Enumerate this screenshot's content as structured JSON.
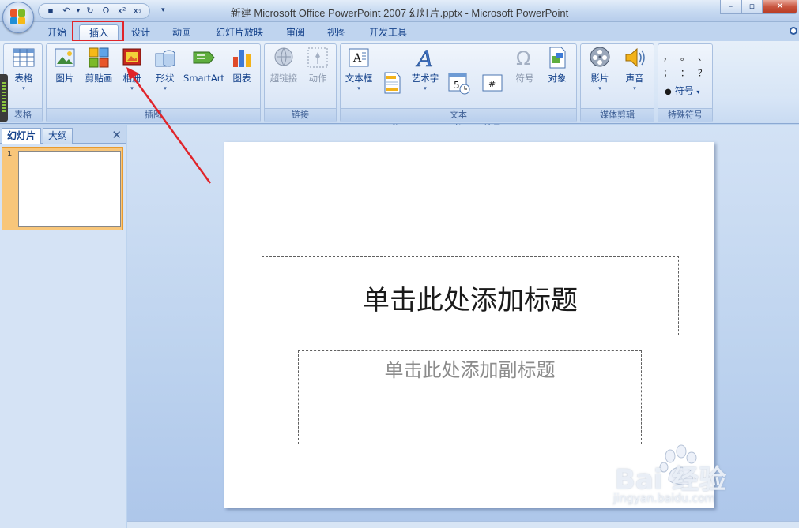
{
  "window": {
    "title": "新建 Microsoft Office PowerPoint 2007 幻灯片.pptx - Microsoft PowerPoint",
    "minimize": "–",
    "maximize": "▫",
    "close": "✕"
  },
  "qat": {
    "save": "▪",
    "undo": "↶",
    "undo_dd": "▾",
    "redo": "↻",
    "preview": "Ω",
    "superscript": "x²",
    "subscript": "x₂",
    "more": "▾"
  },
  "tabs": [
    "开始",
    "插入",
    "设计",
    "动画",
    "幻灯片放映",
    "审阅",
    "视图",
    "开发工具"
  ],
  "active_tab": "插入",
  "ribbon": {
    "groups": [
      {
        "label": "表格",
        "buttons": [
          {
            "label": "表格",
            "arrow": "▾"
          }
        ]
      },
      {
        "label": "插图",
        "buttons": [
          {
            "label": "图片",
            "arrow": ""
          },
          {
            "label": "剪贴画",
            "arrow": ""
          },
          {
            "label": "相册",
            "arrow": "▾"
          },
          {
            "label": "形状",
            "arrow": "▾"
          },
          {
            "label": "SmartArt",
            "arrow": ""
          },
          {
            "label": "图表",
            "arrow": ""
          }
        ]
      },
      {
        "label": "链接",
        "buttons": [
          {
            "label": "超链接",
            "arrow": ""
          },
          {
            "label": "动作",
            "arrow": ""
          }
        ]
      },
      {
        "label": "文本",
        "buttons": [
          {
            "label": "文本框",
            "arrow": "▾"
          },
          {
            "label": "页眉和\n页脚",
            "arrow": ""
          },
          {
            "label": "艺术字",
            "arrow": "▾"
          },
          {
            "label": "日期和\n时间",
            "arrow": ""
          },
          {
            "label": "幻灯片\n编号",
            "arrow": ""
          },
          {
            "label": "符号",
            "arrow": ""
          },
          {
            "label": "对象",
            "arrow": ""
          }
        ]
      },
      {
        "label": "媒体剪辑",
        "buttons": [
          {
            "label": "影片",
            "arrow": "▾"
          },
          {
            "label": "声音",
            "arrow": "▾"
          }
        ]
      },
      {
        "label": "特殊符号",
        "buttons": [
          {
            "label": "符号",
            "arrow": "▾"
          }
        ]
      }
    ],
    "special_symbols": [
      "，",
      "。",
      "、",
      "；",
      "：",
      "？"
    ]
  },
  "left_panel": {
    "tabs": [
      "幻灯片",
      "大纲"
    ],
    "close": "✕",
    "slide_number": "1"
  },
  "slide": {
    "title_placeholder": "单击此处添加标题",
    "subtitle_placeholder": "单击此处添加副标题"
  },
  "watermark": {
    "brand": "Bai  经验",
    "url": "jingyan.baidu.com"
  },
  "colors": {
    "annotation_red": "#e0242a",
    "ribbon_text": "#15428b",
    "thumb_highlight": "#f8c67a"
  }
}
